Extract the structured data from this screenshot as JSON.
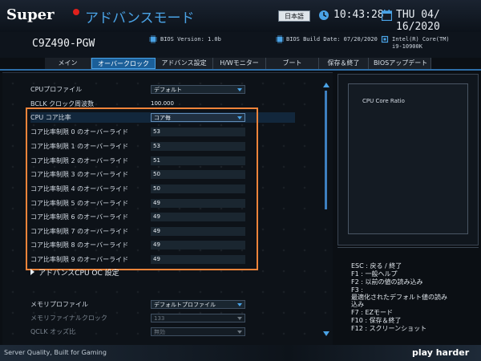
{
  "header": {
    "brand": "Super",
    "mode_title": "アドバンスモード",
    "language_button": "日本語",
    "time": "10:43:28",
    "date": "THU 04/ 16/2020"
  },
  "info": {
    "model": "C9Z490-PGW",
    "bios_version": "BIOS Version: 1.0b",
    "bios_build_date": "BIOS Build Date: 07/20/2020",
    "cpu_line1": "Intel(R) Core(TM)",
    "cpu_line2": "i9-10900K"
  },
  "tabs": [
    "メイン",
    "オーバークロック",
    "アドバンス設定",
    "H/Wモニター",
    "ブート",
    "保存＆終了",
    "BIOSアップデート"
  ],
  "active_tab_index": 1,
  "settings": {
    "cpu_profile": {
      "label": "CPUプロファイル",
      "value": "デフォルト"
    },
    "bclk": {
      "label": "BCLK クロック周波数",
      "value": "100.000"
    },
    "cpu_core_ratio": {
      "label": "CPU コア比率",
      "value": "コア毎"
    },
    "overrides": [
      {
        "label": "コア比率制限 0 のオーバーライド",
        "value": "53"
      },
      {
        "label": "コア比率制限 1 のオーバーライド",
        "value": "53"
      },
      {
        "label": "コア比率制限 2 のオーバーライド",
        "value": "51"
      },
      {
        "label": "コア比率制限 3 のオーバーライド",
        "value": "50"
      },
      {
        "label": "コア比率制限 4 のオーバーライド",
        "value": "50"
      },
      {
        "label": "コア比率制限 5 のオーバーライド",
        "value": "49"
      },
      {
        "label": "コア比率制限 6 のオーバーライド",
        "value": "49"
      },
      {
        "label": "コア比率制限 7 のオーバーライド",
        "value": "49"
      },
      {
        "label": "コア比率制限 8 のオーバーライド",
        "value": "49"
      },
      {
        "label": "コア比率制限 9 のオーバーライド",
        "value": "49"
      }
    ],
    "advanced_cpu_oc": "アドバンスCPU OC 設定",
    "memory_profile": {
      "label": "メモリプロファイル",
      "value": "デフォルトプロファイル"
    },
    "memory_final_clock": {
      "label": "メモリファイナルクロック",
      "value": "133"
    },
    "qclk_odds": {
      "label": "QCLK オッズ比",
      "value": "無効"
    }
  },
  "help": {
    "title": "CPU Core Ratio"
  },
  "keys": [
    "ESC : 戻る / 終了",
    "F1  : 一般ヘルプ",
    "F2  : 以前の値の読み込み",
    "F3  :",
    "最適化されたデフォルト値の読み",
    "込み",
    "F7  : EZモード",
    "F10 : 保存＆終了",
    "F12 : スクリーンショット"
  ],
  "footer": {
    "tagline": "Server Quality, Built for Gaming",
    "slogan": "play harder"
  },
  "colors": {
    "accent": "#4aa3e6",
    "highlight_box": "#f0843a",
    "brand_dot": "#e0201c"
  }
}
